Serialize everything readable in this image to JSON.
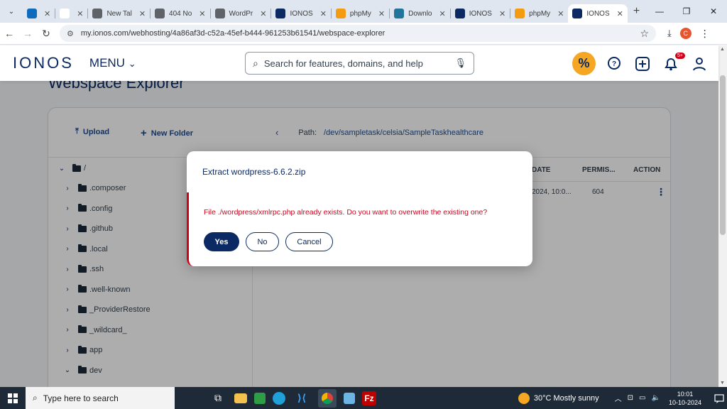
{
  "browser": {
    "tabs": [
      {
        "label": "",
        "icon": "outlook-icon",
        "color": "#0f6cbd"
      },
      {
        "label": "",
        "icon": "google-icon",
        "color": "#ffffff"
      },
      {
        "label": "New Tal",
        "icon": "chrome-icon",
        "color": "#5f6368"
      },
      {
        "label": "404 No",
        "icon": "globe-icon",
        "color": "#5f6368"
      },
      {
        "label": "WordPr",
        "icon": "globe-icon",
        "color": "#5f6368"
      },
      {
        "label": "IONOS",
        "icon": "ionos-icon",
        "color": "#0b2a63"
      },
      {
        "label": "phpMy",
        "icon": "phpmyadmin-icon",
        "color": "#f39c12"
      },
      {
        "label": "Downlo",
        "icon": "wordpress-icon",
        "color": "#21759b"
      },
      {
        "label": "IONOS",
        "icon": "ionos-icon",
        "color": "#0b2a63"
      },
      {
        "label": "phpMy",
        "icon": "phpmyadmin-icon",
        "color": "#f39c12"
      },
      {
        "label": "IONOS",
        "icon": "ionos-icon",
        "color": "#0b2a63",
        "active": true
      }
    ],
    "url": "my.ionos.com/webhosting/4a86af3d-c52a-45ef-b444-961253b61541/webspace-explorer",
    "profile_initial": "C"
  },
  "header": {
    "logo": "IONOS",
    "menu_label": "MENU",
    "search_placeholder": "Search for features, domains, and help",
    "promo_label": "%",
    "notification_badge": "5+"
  },
  "page": {
    "title": "Webspace Explorer",
    "upload_label": "Upload",
    "new_folder_label": "New Folder",
    "path_label": "Path:",
    "path_value": "/dev/sampletask/celsia/SampleTaskhealthcare"
  },
  "tree": {
    "root": "/",
    "items": [
      ".composer",
      ".config",
      ".github",
      ".local",
      ".ssh",
      ".well-known",
      "_ProviderRestore",
      "_wildcard_",
      "app",
      "dev"
    ]
  },
  "table": {
    "columns": {
      "date": "DATE",
      "permissions": "PERMIS...",
      "action": "ACTION"
    },
    "rows": [
      {
        "date": "2024, 10:0...",
        "permissions": "604"
      }
    ]
  },
  "dialog": {
    "title": "Extract wordpress-6.6.2.zip",
    "message": "File ./wordpress/xmlrpc.php already exists. Do you want to overwrite the existing one?",
    "yes_label": "Yes",
    "no_label": "No",
    "cancel_label": "Cancel"
  },
  "taskbar": {
    "search_placeholder": "Type here to search",
    "weather": "30°C  Mostly sunny",
    "time": "10:01",
    "date": "10-10-2024"
  }
}
